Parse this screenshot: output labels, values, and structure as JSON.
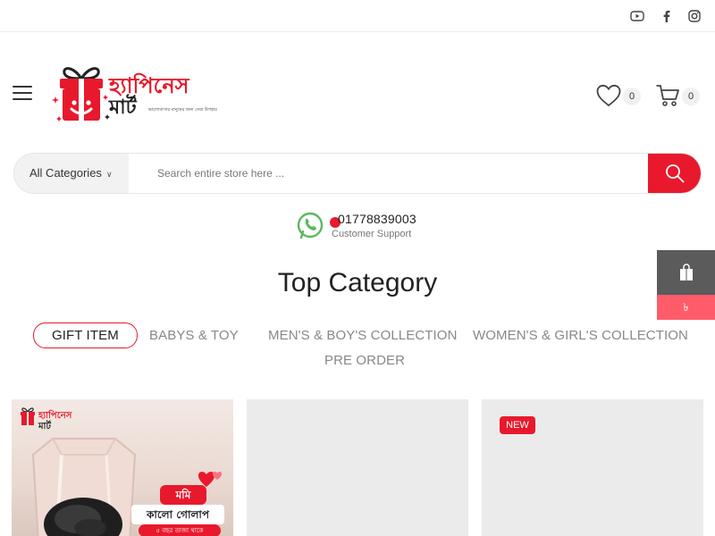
{
  "social": {
    "youtube_icon": "youtube-icon",
    "facebook_icon": "facebook-icon",
    "instagram_icon": "instagram-icon"
  },
  "logo": {
    "line1": "হ্যাপিনেস",
    "line2": "মার্ট",
    "tagline": "ভালোবাসার মানুষের জন্য সেরা উপহার"
  },
  "header": {
    "wishlist_count": "0",
    "cart_count": "0"
  },
  "search": {
    "category_label": "All Categories",
    "placeholder": "Search entire store here ..."
  },
  "support": {
    "phone": "01778839003",
    "label": "Customer Support"
  },
  "floating_cart": {
    "count": "৳"
  },
  "category": {
    "title": "Top Category",
    "tabs": [
      {
        "label": "GIFT ITEM"
      },
      {
        "label": "BABYS & TOY"
      },
      {
        "label": "MEN'S & BOY'S COLLECTION"
      },
      {
        "label": "WOMEN'S & GIRL'S COLLECTION"
      },
      {
        "label": "PRE ORDER"
      }
    ],
    "active_tab": "GIFT ITEM"
  },
  "products": [
    {
      "logo_a": "হ্যাপিনেস",
      "logo_b": "মার্ট",
      "label": "মমি",
      "subtitle": "কালো গোলাপ",
      "strip": "৫ বছর তাজা থাকে"
    },
    {},
    {
      "badge": "NEW"
    }
  ],
  "colors": {
    "accent": "#e8192c",
    "support_green": "#5cb85c",
    "float_dark": "#5b5b5b",
    "float_pink": "#ff5c6a"
  }
}
